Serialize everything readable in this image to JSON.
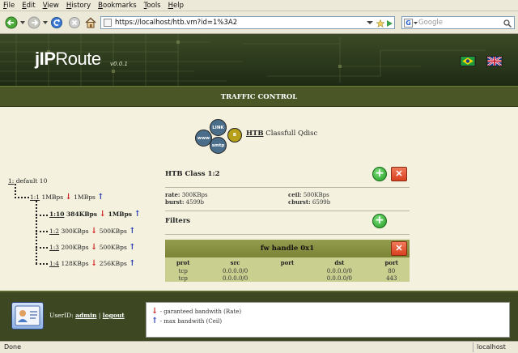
{
  "browser": {
    "menu": [
      "File",
      "Edit",
      "View",
      "History",
      "Bookmarks",
      "Tools",
      "Help"
    ],
    "url": "https://localhost/htb.vm?id=1%3A2",
    "search_placeholder": "Google",
    "status_left": "Done",
    "status_right": "localhost"
  },
  "header": {
    "brand_jip": "jIP",
    "brand_route": "Route",
    "version": "v0.0.1"
  },
  "page_title": "TRAFFIC CONTROL",
  "qdisc": {
    "bubbles": [
      "LINK",
      "www",
      "smtp",
      "B"
    ],
    "name": "HTB",
    "label": " Classfull Qdisc"
  },
  "tree": {
    "root": {
      "id": "1:",
      "label": " default 10"
    },
    "class_1_1": {
      "id": "1:1",
      "rate": " 1MBps",
      "ceil": " 1MBps"
    },
    "children": [
      {
        "id": "1:10",
        "rate": " 384KBps",
        "ceil": " 1MBps",
        "active": true
      },
      {
        "id": "1:2",
        "rate": " 300KBps",
        "ceil": " 500KBps"
      },
      {
        "id": "1:3",
        "rate": " 200KBps",
        "ceil": " 500KBps"
      },
      {
        "id": "1:4",
        "rate": " 128KBps",
        "ceil": " 256KBps"
      }
    ],
    "down_arrow": "↓",
    "up_arrow": "↑"
  },
  "class_panel": {
    "title": "HTB Class 1:2",
    "rate_label": "rate:",
    "rate": " 300KBps",
    "burst_label": "burst:",
    "burst": " 4599b",
    "ceil_label": "ceil:",
    "ceil": " 500KBps",
    "cburst_label": "cburst:",
    "cburst": " 6599b",
    "filters_title": "Filters",
    "add_symbol": "+",
    "del_symbol": "✕"
  },
  "filter": {
    "title": "fw handle 0x1",
    "columns": [
      "prot",
      "src",
      "port",
      "dst",
      "port"
    ],
    "rows": [
      [
        "tcp",
        "0.0.0.0/0",
        "",
        "0.0.0.0/0",
        "80"
      ],
      [
        "tcp",
        "0.0.0.0/0",
        "",
        "0.0.0.0/0",
        "443"
      ]
    ]
  },
  "footer": {
    "userid_label": "UserID: ",
    "username": "admin",
    "sep": " | ",
    "logout": "logout",
    "legend_rate": " - garanteed bandwith (Rate)",
    "legend_ceil": " - max bandwith (Ceil)"
  },
  "colors": {
    "header_bg": "#2d3b1d",
    "title_bar": "#4b5627",
    "content_bg": "#f4f2df",
    "filter_head": "#7b8435",
    "arrow_down": "#cc1b1b",
    "arrow_up": "#1b2fb0"
  }
}
